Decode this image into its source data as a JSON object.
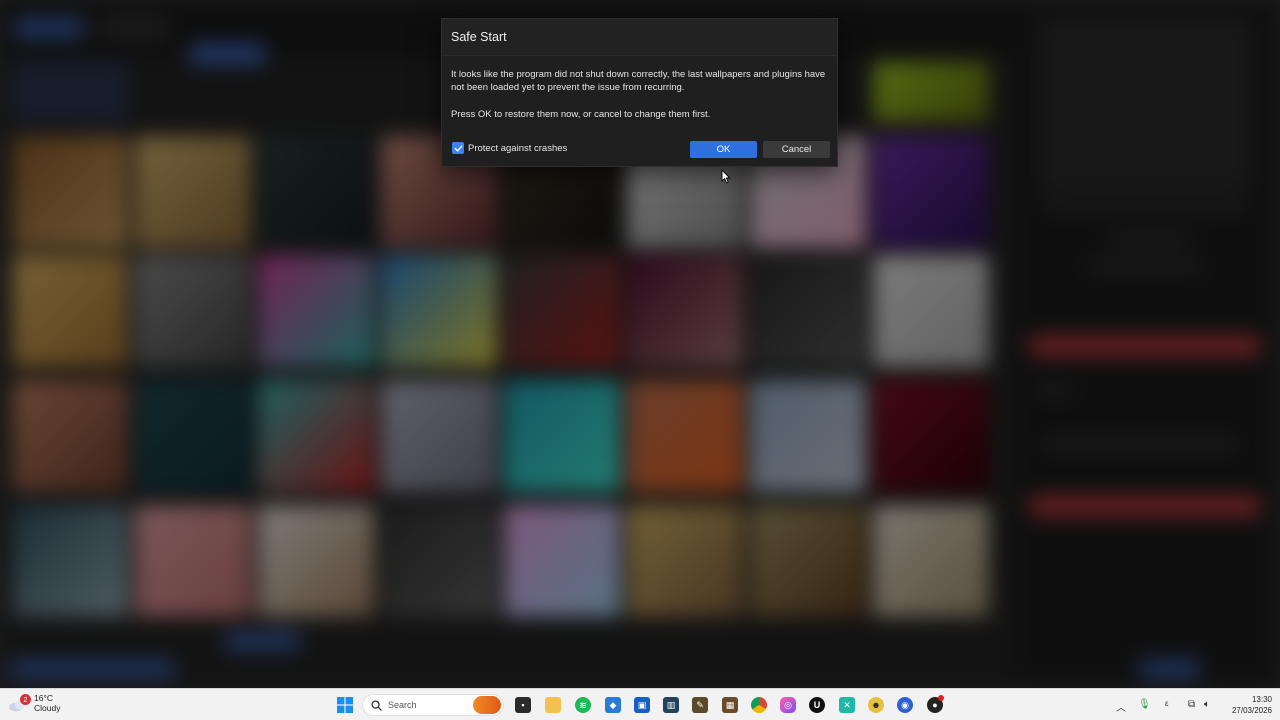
{
  "dialog": {
    "title": "Safe Start",
    "message_line1": "It looks like the program did not shut down correctly, the last wallpapers and plugins have not been loaded yet to prevent the issue from recurring.",
    "message_line2": "Press OK to restore them now, or cancel to change them first.",
    "checkbox_label": "Protect against crashes",
    "checkbox_checked": true,
    "ok_label": "OK",
    "cancel_label": "Cancel"
  },
  "taskbar": {
    "weather": {
      "temperature": "16°C",
      "condition": "Cloudy",
      "badge_count": "2"
    },
    "search_placeholder": "Search",
    "pinned_apps": [
      "file-explorer-icon",
      "folder-icon",
      "spotify-icon",
      "stack-app-icon",
      "store-icon",
      "dev-tool-icon",
      "editor-icon",
      "minecraft-icon",
      "chrome-icon",
      "paint-app-icon",
      "unreal-engine-icon",
      "spreadsheet-icon",
      "avatar-app-icon",
      "wallpaper-engine-icon",
      "obs-icon"
    ],
    "clock": {
      "time": "13:30",
      "date": "27/03/2026"
    }
  },
  "colors": {
    "ok_button": "#2f6fe0",
    "checkbox": "#3b82f6",
    "dialog_bg": "#1f1f1f"
  }
}
